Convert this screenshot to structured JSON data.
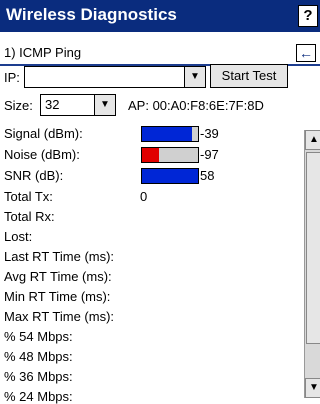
{
  "app": {
    "title": "Wireless Diagnostics",
    "help_label": "?"
  },
  "mode": {
    "label": "1) ICMP Ping",
    "back_icon": "←"
  },
  "ip": {
    "label": "IP:",
    "value": "",
    "start_button": "Start Test"
  },
  "size": {
    "label": "Size:",
    "value": "32",
    "ap_text": "AP: 00:A0:F8:6E:7F:8D"
  },
  "metrics": {
    "signal": {
      "label": "Signal (dBm):",
      "value": "-39",
      "percent": 90,
      "color": "#0026d6"
    },
    "noise": {
      "label": "Noise (dBm):",
      "value": "-97",
      "percent": 30,
      "color": "#e10000"
    },
    "snr": {
      "label": "SNR (dB):",
      "value": "58",
      "percent": 100,
      "color": "#0026d6"
    },
    "total_tx": {
      "label": "Total Tx:",
      "value": "0"
    },
    "total_rx": {
      "label": "Total Rx:"
    },
    "lost": {
      "label": "Lost:"
    },
    "last_rt": {
      "label": "Last RT Time (ms):"
    },
    "avg_rt": {
      "label": "Avg RT Time (ms):"
    },
    "min_rt": {
      "label": "Min RT Time (ms):"
    },
    "max_rt": {
      "label": "Max RT Time (ms):"
    },
    "p54": {
      "label": "% 54 Mbps:"
    },
    "p48": {
      "label": "% 48 Mbps:"
    },
    "p36": {
      "label": "% 36 Mbps:"
    },
    "p24": {
      "label": "% 24 Mbps:"
    }
  }
}
